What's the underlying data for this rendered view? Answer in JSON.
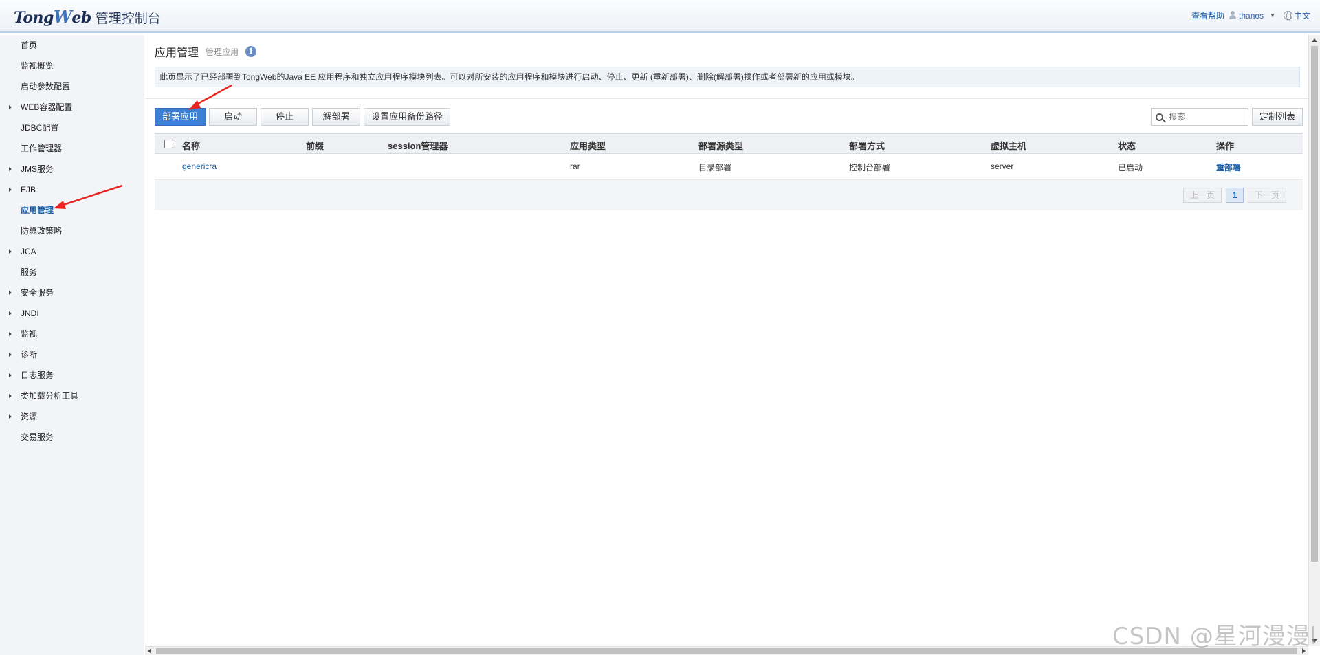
{
  "header": {
    "logo_brand_a": "Tong",
    "logo_brand_w": "W",
    "logo_brand_b": "eb",
    "logo_subtitle": "管理控制台",
    "help_label": "查看帮助",
    "username": "thanos",
    "language": "中文"
  },
  "sidebar": {
    "items": [
      {
        "label": "首页",
        "expandable": false
      },
      {
        "label": "监视概览",
        "expandable": false
      },
      {
        "label": "启动参数配置",
        "expandable": false
      },
      {
        "label": "WEB容器配置",
        "expandable": true
      },
      {
        "label": "JDBC配置",
        "expandable": false
      },
      {
        "label": "工作管理器",
        "expandable": false
      },
      {
        "label": "JMS服务",
        "expandable": true
      },
      {
        "label": "EJB",
        "expandable": true
      },
      {
        "label": "应用管理",
        "expandable": false,
        "active": true
      },
      {
        "label": "防篡改策略",
        "expandable": false
      },
      {
        "label": "JCA",
        "expandable": true
      },
      {
        "label": "服务",
        "expandable": false
      },
      {
        "label": "安全服务",
        "expandable": true
      },
      {
        "label": "JNDI",
        "expandable": true
      },
      {
        "label": "监视",
        "expandable": true
      },
      {
        "label": "诊断",
        "expandable": true
      },
      {
        "label": "日志服务",
        "expandable": true
      },
      {
        "label": "类加载分析工具",
        "expandable": true
      },
      {
        "label": "资源",
        "expandable": true
      },
      {
        "label": "交易服务",
        "expandable": false
      }
    ]
  },
  "main": {
    "title": "应用管理",
    "subtitle": "管理应用",
    "info_glyph": "i",
    "description": "此页显示了已经部署到TongWeb的Java EE 应用程序和独立应用程序模块列表。可以对所安装的应用程序和模块进行启动、停止、更新 (重新部署)、删除(解部署)操作或者部署新的应用或模块。",
    "toolbar": {
      "deploy": "部署应用",
      "start": "启动",
      "stop": "停止",
      "undeploy": "解部署",
      "backup_path": "设置应用备份路径"
    },
    "search_placeholder": "搜索",
    "customize_columns": "定制列表",
    "table": {
      "headers": {
        "name": "名称",
        "prefix": "前缀",
        "session": "session管理器",
        "app_type": "应用类型",
        "source_type": "部署源类型",
        "deploy_mode": "部署方式",
        "virtual_host": "虚拟主机",
        "status": "状态",
        "action": "操作"
      },
      "rows": [
        {
          "name": "genericra",
          "prefix": "",
          "session": "",
          "app_type": "rar",
          "source_type": "目录部署",
          "deploy_mode": "控制台部署",
          "virtual_host": "server",
          "status": "已启动",
          "action": "重部署"
        }
      ]
    },
    "pagination": {
      "prev": "上一页",
      "current_page": "1",
      "next": "下一页"
    }
  },
  "watermark": "CSDN @星河漫漫l",
  "colors": {
    "primary_button": "#3c80d6",
    "link": "#1a5fa8",
    "annotation_arrow": "#e8251f"
  }
}
